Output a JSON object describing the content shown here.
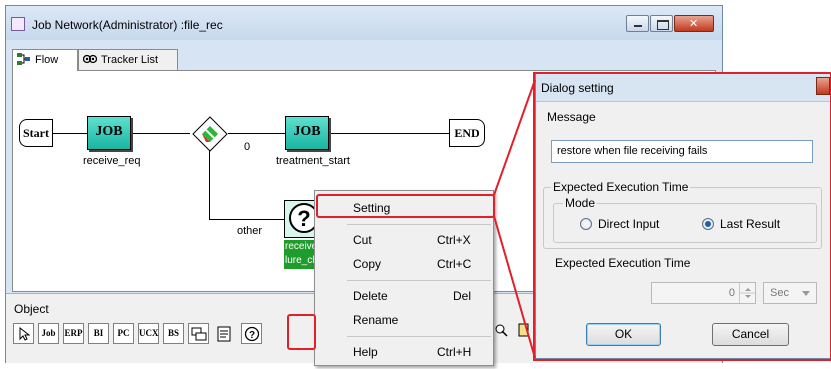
{
  "window": {
    "title": "Job Network(Administrator) :file_rec",
    "tabs": [
      {
        "label": "Flow",
        "icon": "flow-icon"
      },
      {
        "label": "Tracker List",
        "icon": "tracker-icon"
      }
    ]
  },
  "flow": {
    "start_label": "Start",
    "end_label": "END",
    "jobs": [
      {
        "text": "JOB",
        "caption": "receive_req"
      },
      {
        "text": "JOB",
        "caption": "treatment_start"
      }
    ],
    "branch_labels": [
      "0",
      "other"
    ],
    "dialog_node": {
      "caption_line1": "receive",
      "caption_line2": "lure_ch"
    }
  },
  "object_panel": {
    "label": "Object",
    "tools": [
      "Job",
      "ERP",
      "BI",
      "PC",
      "UCX",
      "BS"
    ]
  },
  "context_menu": {
    "items": [
      {
        "label": "Setting",
        "shortcut": ""
      },
      {
        "label": "Cut",
        "shortcut": "Ctrl+X"
      },
      {
        "label": "Copy",
        "shortcut": "Ctrl+C"
      },
      {
        "label": "Delete",
        "shortcut": "Del"
      },
      {
        "label": "Rename",
        "shortcut": ""
      },
      {
        "label": "Help",
        "shortcut": "Ctrl+H"
      }
    ]
  },
  "dialog": {
    "title": "Dialog setting",
    "message_label": "Message",
    "message_value": "restore when file receiving fails",
    "exec_group_label": "Expected Execution Time",
    "mode_label": "Mode",
    "mode_options": [
      {
        "label": "Direct Input",
        "selected": false
      },
      {
        "label": "Last Result",
        "selected": true
      }
    ],
    "exec_time_label": "Expected Execution Time",
    "exec_time_value": "0",
    "exec_time_unit": "Sec",
    "ok_label": "OK",
    "cancel_label": "Cancel"
  },
  "colors": {
    "annotation": "#e0202a",
    "job_fill": "#19b5a3",
    "selected_label_bg": "#1f9d2c"
  }
}
